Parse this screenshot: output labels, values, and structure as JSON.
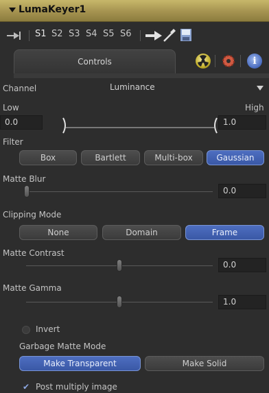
{
  "header": {
    "tool_name": "LumaKeyer1"
  },
  "toolbar": {
    "slots": [
      "S1",
      "S2",
      "S3",
      "S4",
      "S5",
      "S6"
    ]
  },
  "tabs": {
    "controls": "Controls"
  },
  "channel": {
    "label": "Channel",
    "value": "Luminance"
  },
  "range": {
    "low_label": "Low",
    "high_label": "High",
    "low_value": "0.0",
    "high_value": "1.0",
    "low": 0.0,
    "high": 1.0
  },
  "filter": {
    "label": "Filter",
    "options": [
      "Box",
      "Bartlett",
      "Multi-box",
      "Gaussian"
    ],
    "selected": "Gaussian"
  },
  "matte_blur": {
    "label": "Matte Blur",
    "value": "0.0"
  },
  "clipping": {
    "label": "Clipping Mode",
    "options": [
      "None",
      "Domain",
      "Frame"
    ],
    "selected": "Frame"
  },
  "matte_contrast": {
    "label": "Matte Contrast",
    "value": "0.0"
  },
  "matte_gamma": {
    "label": "Matte Gamma",
    "value": "1.0"
  },
  "invert": {
    "label": "Invert",
    "checked": false
  },
  "garbage": {
    "label": "Garbage Matte Mode",
    "options": [
      "Make Transparent",
      "Make Solid"
    ],
    "selected": "Make Transparent"
  },
  "post_multiply": {
    "label": "Post multiply image",
    "checked": true
  },
  "colors": {
    "header": "#a59350",
    "accent": "#4566b8",
    "panel": "#2d2d2d"
  }
}
